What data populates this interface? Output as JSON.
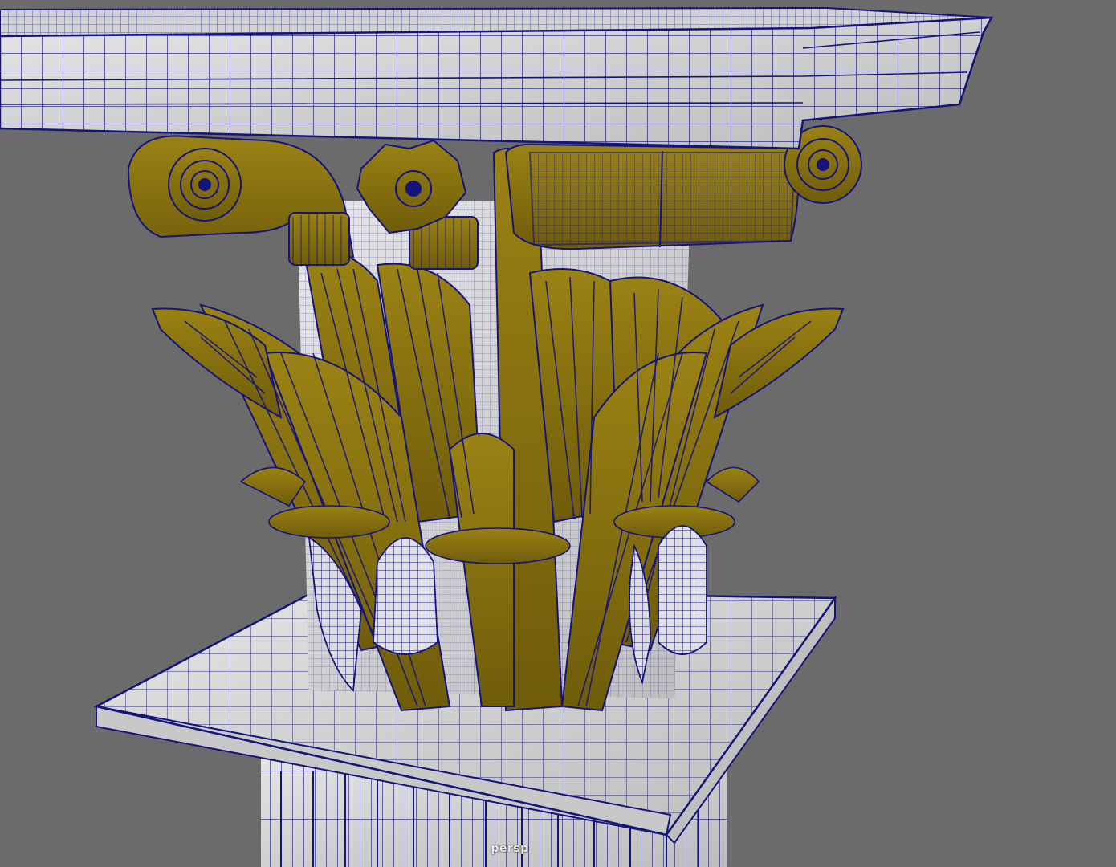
{
  "viewport": {
    "camera_label": "persp",
    "background_color": "#6b6b6b",
    "wireframe_color": "#14147a",
    "gold_color": "#8a7410",
    "marble_color": "#d9d9d9"
  },
  "scene": {
    "objects": [
      "entablature-molding",
      "left-volute-scroll",
      "right-volute-scroll",
      "rosette-flower",
      "acanthus-leaves",
      "abacus-slab",
      "fluted-column-shaft",
      "capital-bell"
    ]
  }
}
